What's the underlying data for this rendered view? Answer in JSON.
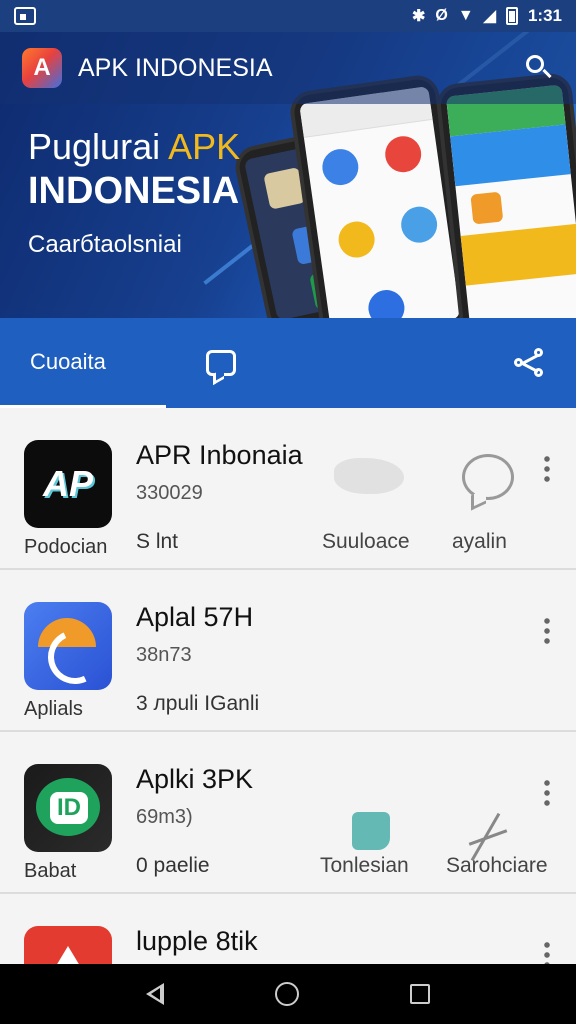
{
  "status_bar": {
    "time": "1:31"
  },
  "header": {
    "title": "APK INDONESIA"
  },
  "banner": {
    "line1_part1": "Puglurai ",
    "line1_accent": "APK",
    "line2": "INDONESIA",
    "line3": "Caarбtaolsniai"
  },
  "tabs": {
    "active_label": "Cuoaita"
  },
  "list": [
    {
      "title": "APR Inbonaia",
      "subtitle": "330029",
      "caption": "Podocian",
      "line": "S lnt",
      "mid_label": "Suuloace",
      "right_label": "ayalin"
    },
    {
      "title": "Aplal 57H",
      "subtitle": "38n73",
      "caption": "Aplials",
      "line": "3 лpuli IGanli",
      "mid_label": "",
      "right_label": ""
    },
    {
      "title": "Aplki 3PK",
      "subtitle": "69m3)",
      "caption": "Babat",
      "line": "0 paelie",
      "mid_label": "Tonlesian",
      "right_label": "Sarohciare"
    },
    {
      "title": "lupple 8tik",
      "subtitle": "",
      "caption": "",
      "line": "",
      "mid_label": "",
      "right_label": ""
    }
  ],
  "colors": {
    "primary": "#1f5fbf",
    "banner_dark": "#0e2a6e",
    "accent": "#f2b91c"
  }
}
